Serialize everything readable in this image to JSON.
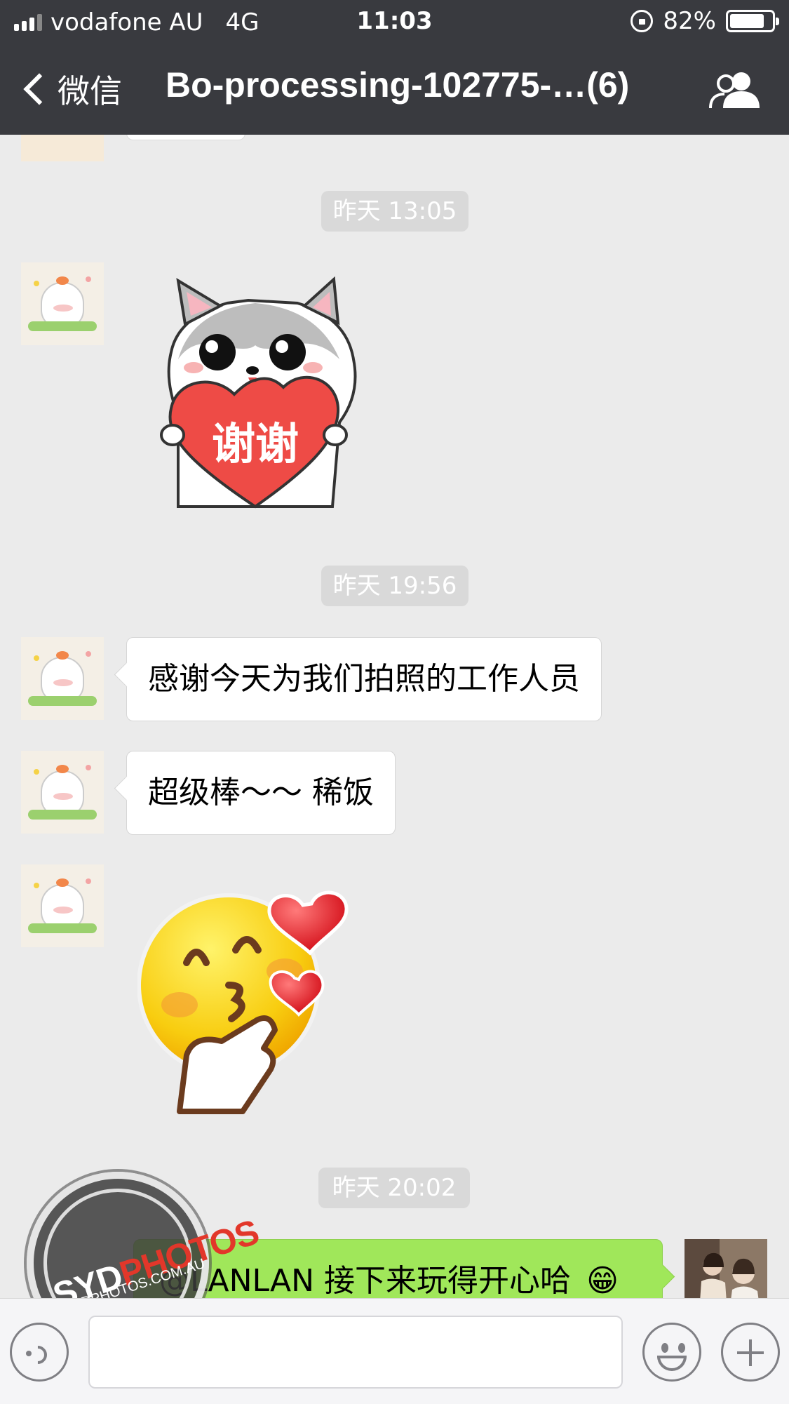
{
  "status_bar": {
    "carrier": "vodafone AU",
    "network": "4G",
    "time": "11:03",
    "battery": "82%",
    "battery_level": 0.82
  },
  "nav": {
    "back_label": "微信",
    "title": "Bo-processing-102775-…(6)",
    "right_icon": "group-people-icon"
  },
  "messages": {
    "ts1": "昨天 13:05",
    "ts2": "昨天 19:56",
    "ts3": "昨天 20:02",
    "msg1": "感谢今天为我们拍照的工作人员",
    "msg2": "超级棒～～ 稀饭",
    "msg3": "@LANLAN 接下来玩得开心哈",
    "sticker1_text": "谢谢",
    "msg3_emoji": "😁"
  },
  "watermark": {
    "brand_a": "SYD",
    "brand_b": "PHOTOS",
    "url": "SYDPHOTOS.COM.AU"
  },
  "input_bar": {
    "value": "",
    "icons": [
      "voice-icon",
      "emoji-icon",
      "plus-icon"
    ]
  },
  "colors": {
    "nav_bg": "#393a3f",
    "chat_bg": "#ebebeb",
    "my_bubble": "#a0e75a",
    "their_bubble": "#ffffff"
  }
}
